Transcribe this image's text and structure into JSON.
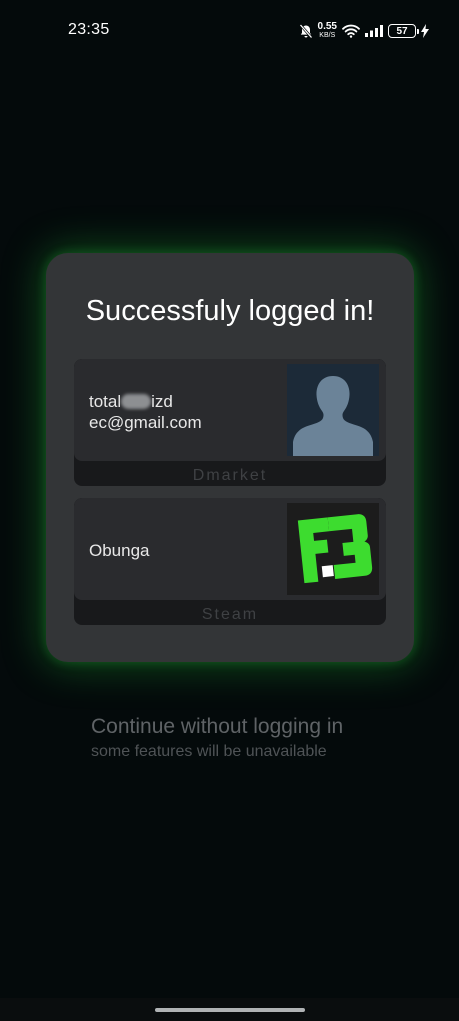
{
  "status_bar": {
    "time": "23:35",
    "net_speed_value": "0.55",
    "net_speed_unit": "KB/S",
    "battery": "57",
    "icons": [
      "mute-bell-icon",
      "wifi-icon",
      "signal-icon",
      "battery-icon",
      "charging-icon"
    ]
  },
  "card": {
    "title": "Successfuly logged in!",
    "accounts": [
      {
        "line1_prefix": "total",
        "line1_suffix": "izd",
        "line2": "ec@gmail.com",
        "platform": "Dmarket",
        "avatar": "default-user-silhouette"
      },
      {
        "name": "Obunga",
        "platform": "Steam",
        "avatar": "fnatic-style-green-logo"
      }
    ]
  },
  "continue": {
    "title": "Continue without logging in",
    "subtitle": "some features will be unavailable"
  },
  "colors": {
    "background": "#040a0b",
    "card": "#333537",
    "glow": "#28c83c",
    "logo_green": "#3ddc2f"
  }
}
